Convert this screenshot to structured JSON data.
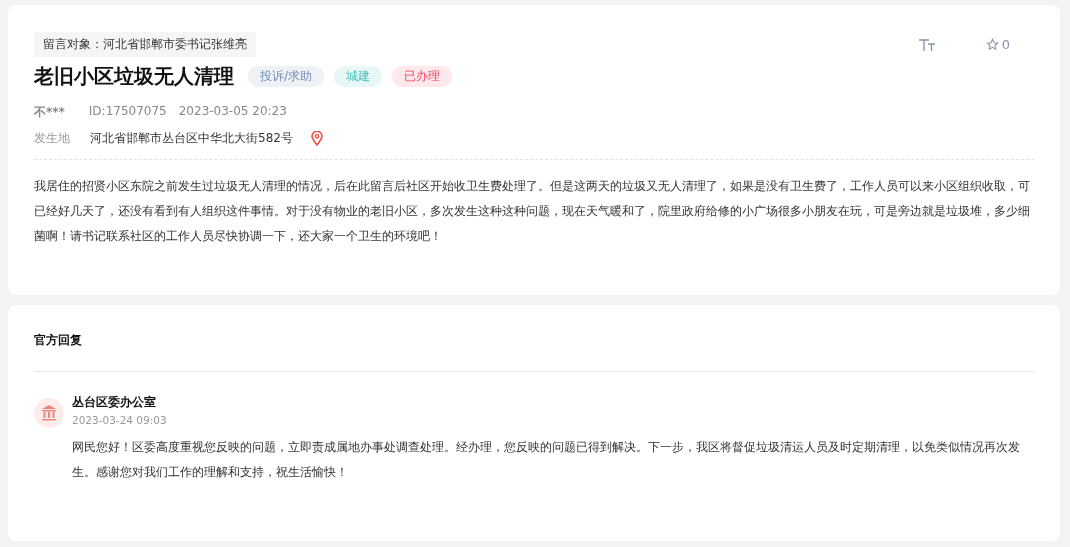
{
  "post": {
    "target": "留言对象：河北省邯郸市委书记张维亮",
    "title": "老旧小区垃圾无人清理",
    "tags": [
      {
        "label": "投诉/求助",
        "color": "#eef1f6"
      },
      {
        "label": "城建",
        "color": "#e8f7f6"
      },
      {
        "label": "已办理",
        "color": "#fde8eb"
      }
    ],
    "favorites": "0",
    "author": "不***",
    "id": "ID:17507075",
    "time": "2023-03-05 20:23",
    "location_label": "发生地",
    "location": "河北省邯郸市丛台区中华北大街582号",
    "body": "我居住的招贤小区东院之前发生过垃圾无人清理的情况，后在此留言后社区开始收卫生费处理了。但是这两天的垃圾又无人清理了，如果是没有卫生费了，工作人员可以来小区组织收取，可已经好几天了，还没有看到有人组织这件事情。对于没有物业的老旧小区，多次发生这种这种问题，现在天气暖和了，院里政府给修的小广场很多小朋友在玩，可是旁边就是垃圾堆，多少细菌啊！请书记联系社区的工作人员尽快协调一下，还大家一个卫生的环境吧！"
  },
  "reply": {
    "heading": "官方回复",
    "org": "丛台区委办公室",
    "time": "2023-03-24 09:03",
    "body": "网民您好！区委高度重视您反映的问题，立即责成属地办事处调查处理。经办理，您反映的问题已得到解决。下一步，我区将督促垃圾清运人员及时定期清理，以免类似情况再次发生。感谢您对我们工作的理解和支持，祝生活愉快！"
  }
}
